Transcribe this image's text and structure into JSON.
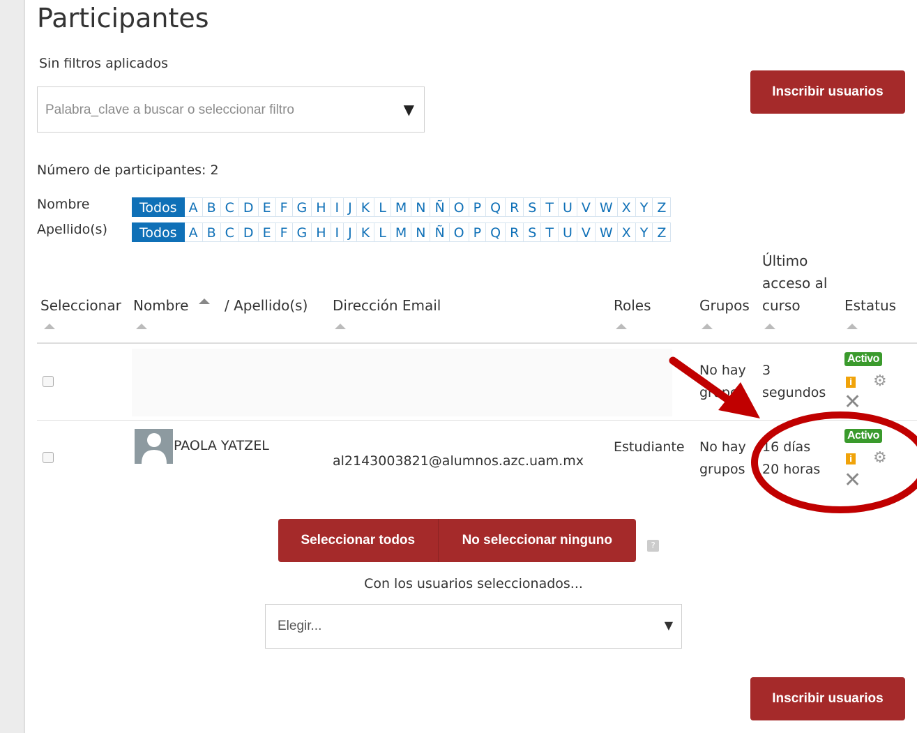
{
  "page": {
    "title": "Participantes",
    "filters_status": "Sin filtros aplicados",
    "filter_placeholder": "Palabra_clave a buscar o seleccionar filtro",
    "enrol_button": "Inscribir usuarios",
    "participant_count": "Número de participantes: 2"
  },
  "initials": {
    "first_label": "Nombre",
    "last_label": "Apellido(s)",
    "all_label": "Todos",
    "letters": [
      "A",
      "B",
      "C",
      "D",
      "E",
      "F",
      "G",
      "H",
      "I",
      "J",
      "K",
      "L",
      "M",
      "N",
      "Ñ",
      "O",
      "P",
      "Q",
      "R",
      "S",
      "T",
      "U",
      "V",
      "W",
      "X",
      "Y",
      "Z"
    ]
  },
  "table": {
    "headers": {
      "select": "Seleccionar",
      "name": "Nombre",
      "surname": "/ Apellido(s)",
      "email": "Dirección Email",
      "roles": "Roles",
      "groups": "Grupos",
      "last_access_1": "Último",
      "last_access_2": "acceso al",
      "last_access_3": "curso",
      "status": "Estatus"
    },
    "rows": [
      {
        "name": "",
        "email": "",
        "role": "",
        "groups_1": "No hay",
        "groups_2": "grupos",
        "access_1": "3",
        "access_2": "segundos",
        "status": "Activo"
      },
      {
        "name": "PAOLA YATZEL",
        "email": "al2143003821@alumnos.azc.uam.mx",
        "role": "Estudiante",
        "groups_1": "No hay",
        "groups_2": "grupos",
        "access_1": "16 días",
        "access_2": "20 horas",
        "status": "Activo"
      }
    ]
  },
  "bulk": {
    "select_all": "Seleccionar todos",
    "select_none": "No seleccionar ninguno",
    "with_selected": "Con los usuarios seleccionados...",
    "choose": "Elegir...",
    "help": "?"
  },
  "colors": {
    "accent_red": "#a52a2a",
    "link_blue": "#0f70b7",
    "active_green": "#3a9a2c",
    "annotation_red": "#c00000"
  }
}
